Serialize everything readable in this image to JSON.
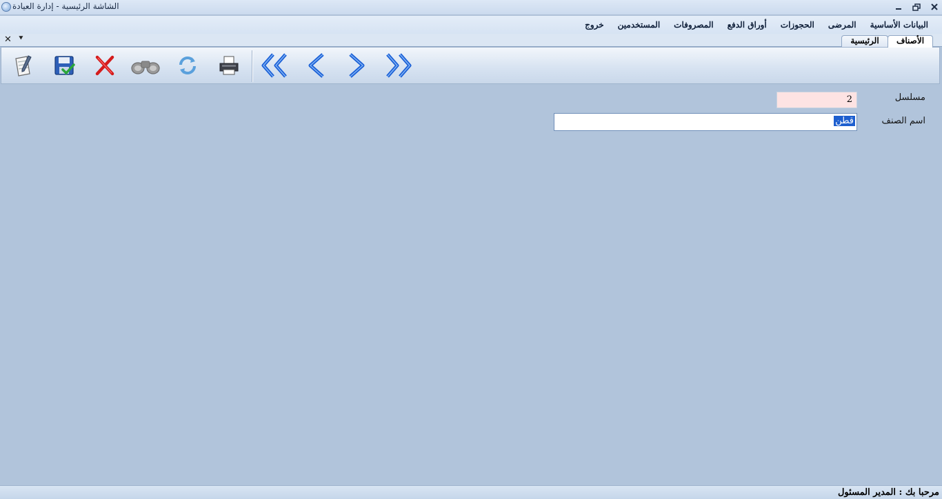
{
  "window": {
    "title": "الشاشة الرئيسية - إدارة العيادة",
    "minimize_icon": "minimize-icon",
    "restore_icon": "restore-icon",
    "close_icon": "close-icon"
  },
  "menu": {
    "items": [
      {
        "label": "البيانات الأساسية"
      },
      {
        "label": "المرضى"
      },
      {
        "label": "الحجوزات"
      },
      {
        "label": "أوراق الدفع"
      },
      {
        "label": "المصروفات"
      },
      {
        "label": "المستخدمين"
      },
      {
        "label": "خروج"
      }
    ]
  },
  "tabs": {
    "items": [
      {
        "label": "الأصناف",
        "active": true
      },
      {
        "label": "الرئيسية",
        "active": false
      }
    ],
    "close_glyph": "✕",
    "menu_glyph": "⯆"
  },
  "toolbar": {
    "buttons": [
      {
        "name": "new",
        "icon": "new-document-icon"
      },
      {
        "name": "save",
        "icon": "save-icon"
      },
      {
        "name": "delete",
        "icon": "delete-icon"
      },
      {
        "name": "search",
        "icon": "binoculars-icon"
      },
      {
        "name": "refresh",
        "icon": "refresh-icon"
      },
      {
        "name": "print",
        "icon": "printer-icon"
      },
      {
        "name": "first",
        "icon": "first-record-icon"
      },
      {
        "name": "previous",
        "icon": "previous-record-icon"
      },
      {
        "name": "next",
        "icon": "next-record-icon"
      },
      {
        "name": "last",
        "icon": "last-record-icon"
      }
    ]
  },
  "form": {
    "serial_label": "مسلسل",
    "serial_value": "2",
    "name_label": "اسم الصنف",
    "name_value": "قطن"
  },
  "status": {
    "text": "مرحبا بك :  المدير المسئول"
  },
  "colors": {
    "background": "#b1c4db",
    "serial_field": "#fde3e3",
    "selection": "#1e5fcf",
    "nav_arrow": "#1a5fd6"
  }
}
